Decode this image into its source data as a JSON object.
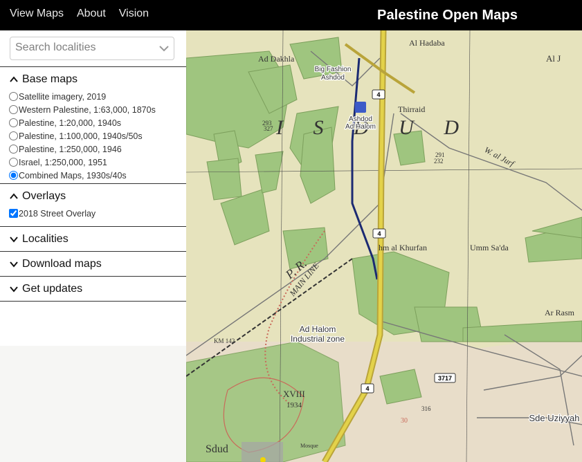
{
  "nav": {
    "items": [
      "View Maps",
      "About",
      "Vision"
    ],
    "brand": "Palestine Open Maps"
  },
  "search": {
    "placeholder": "Search localities",
    "value": ""
  },
  "sections": {
    "base_maps": {
      "title": "Base maps",
      "expanded": true,
      "options": [
        "Satellite imagery, 2019",
        "Western Palestine, 1:63,000, 1870s",
        "Palestine, 1:20,000, 1940s",
        "Palestine, 1:100,000, 1940s/50s",
        "Palestine, 1:250,000, 1946",
        "Israel, 1:250,000, 1951",
        "Combined Maps, 1930s/40s"
      ],
      "selected": "Combined Maps, 1930s/40s"
    },
    "overlays": {
      "title": "Overlays",
      "expanded": true,
      "options": [
        "2018 Street Overlay"
      ],
      "checked": [
        "2018 Street Overlay"
      ]
    },
    "localities": {
      "title": "Localities",
      "expanded": false
    },
    "download": {
      "title": "Download maps",
      "expanded": false
    },
    "updates": {
      "title": "Get updates",
      "expanded": false
    }
  },
  "map": {
    "labels": {
      "ad_dakhla": "Ad Dakhla",
      "al_hadaba": "Al Hadaba",
      "aj": "Al J",
      "big_fashion_1": "Big Fashion",
      "big_fashion_2": "Ashdod",
      "station_1": "Ashdod",
      "station_2": "Ad Halom",
      "thirraid": "Thirraid",
      "isdud": "I S D U D",
      "w_al_jurf": "W. al Jurf",
      "khurfan": "hm al Khurfan",
      "umm_sada": "Umm Sa'da",
      "ar_rasm": "Ar Rasm",
      "main_line": "MAIN LINE",
      "pr": "P. R.",
      "ad_halom_ind_1": "Ad Halom",
      "ad_halom_ind_2": "Industrial zone",
      "km142": "KM 142",
      "xviii": "XVIII",
      "year": "1934",
      "sdud": "Sdud",
      "mosque": "Mosque",
      "sde": "Sde Uziyyah",
      "alt_293": "293",
      "alt_327": "327",
      "alt_291": "291",
      "alt_232": "232",
      "alt_316": "316",
      "alt_30": "30"
    },
    "shields": [
      "4",
      "4",
      "4",
      "3717"
    ],
    "colors": {
      "paper": "#e6e3bd",
      "green": "#9fc57f",
      "road": "#e3d24a",
      "rail": "#1b2a72",
      "pink": "#c96a5a"
    }
  }
}
